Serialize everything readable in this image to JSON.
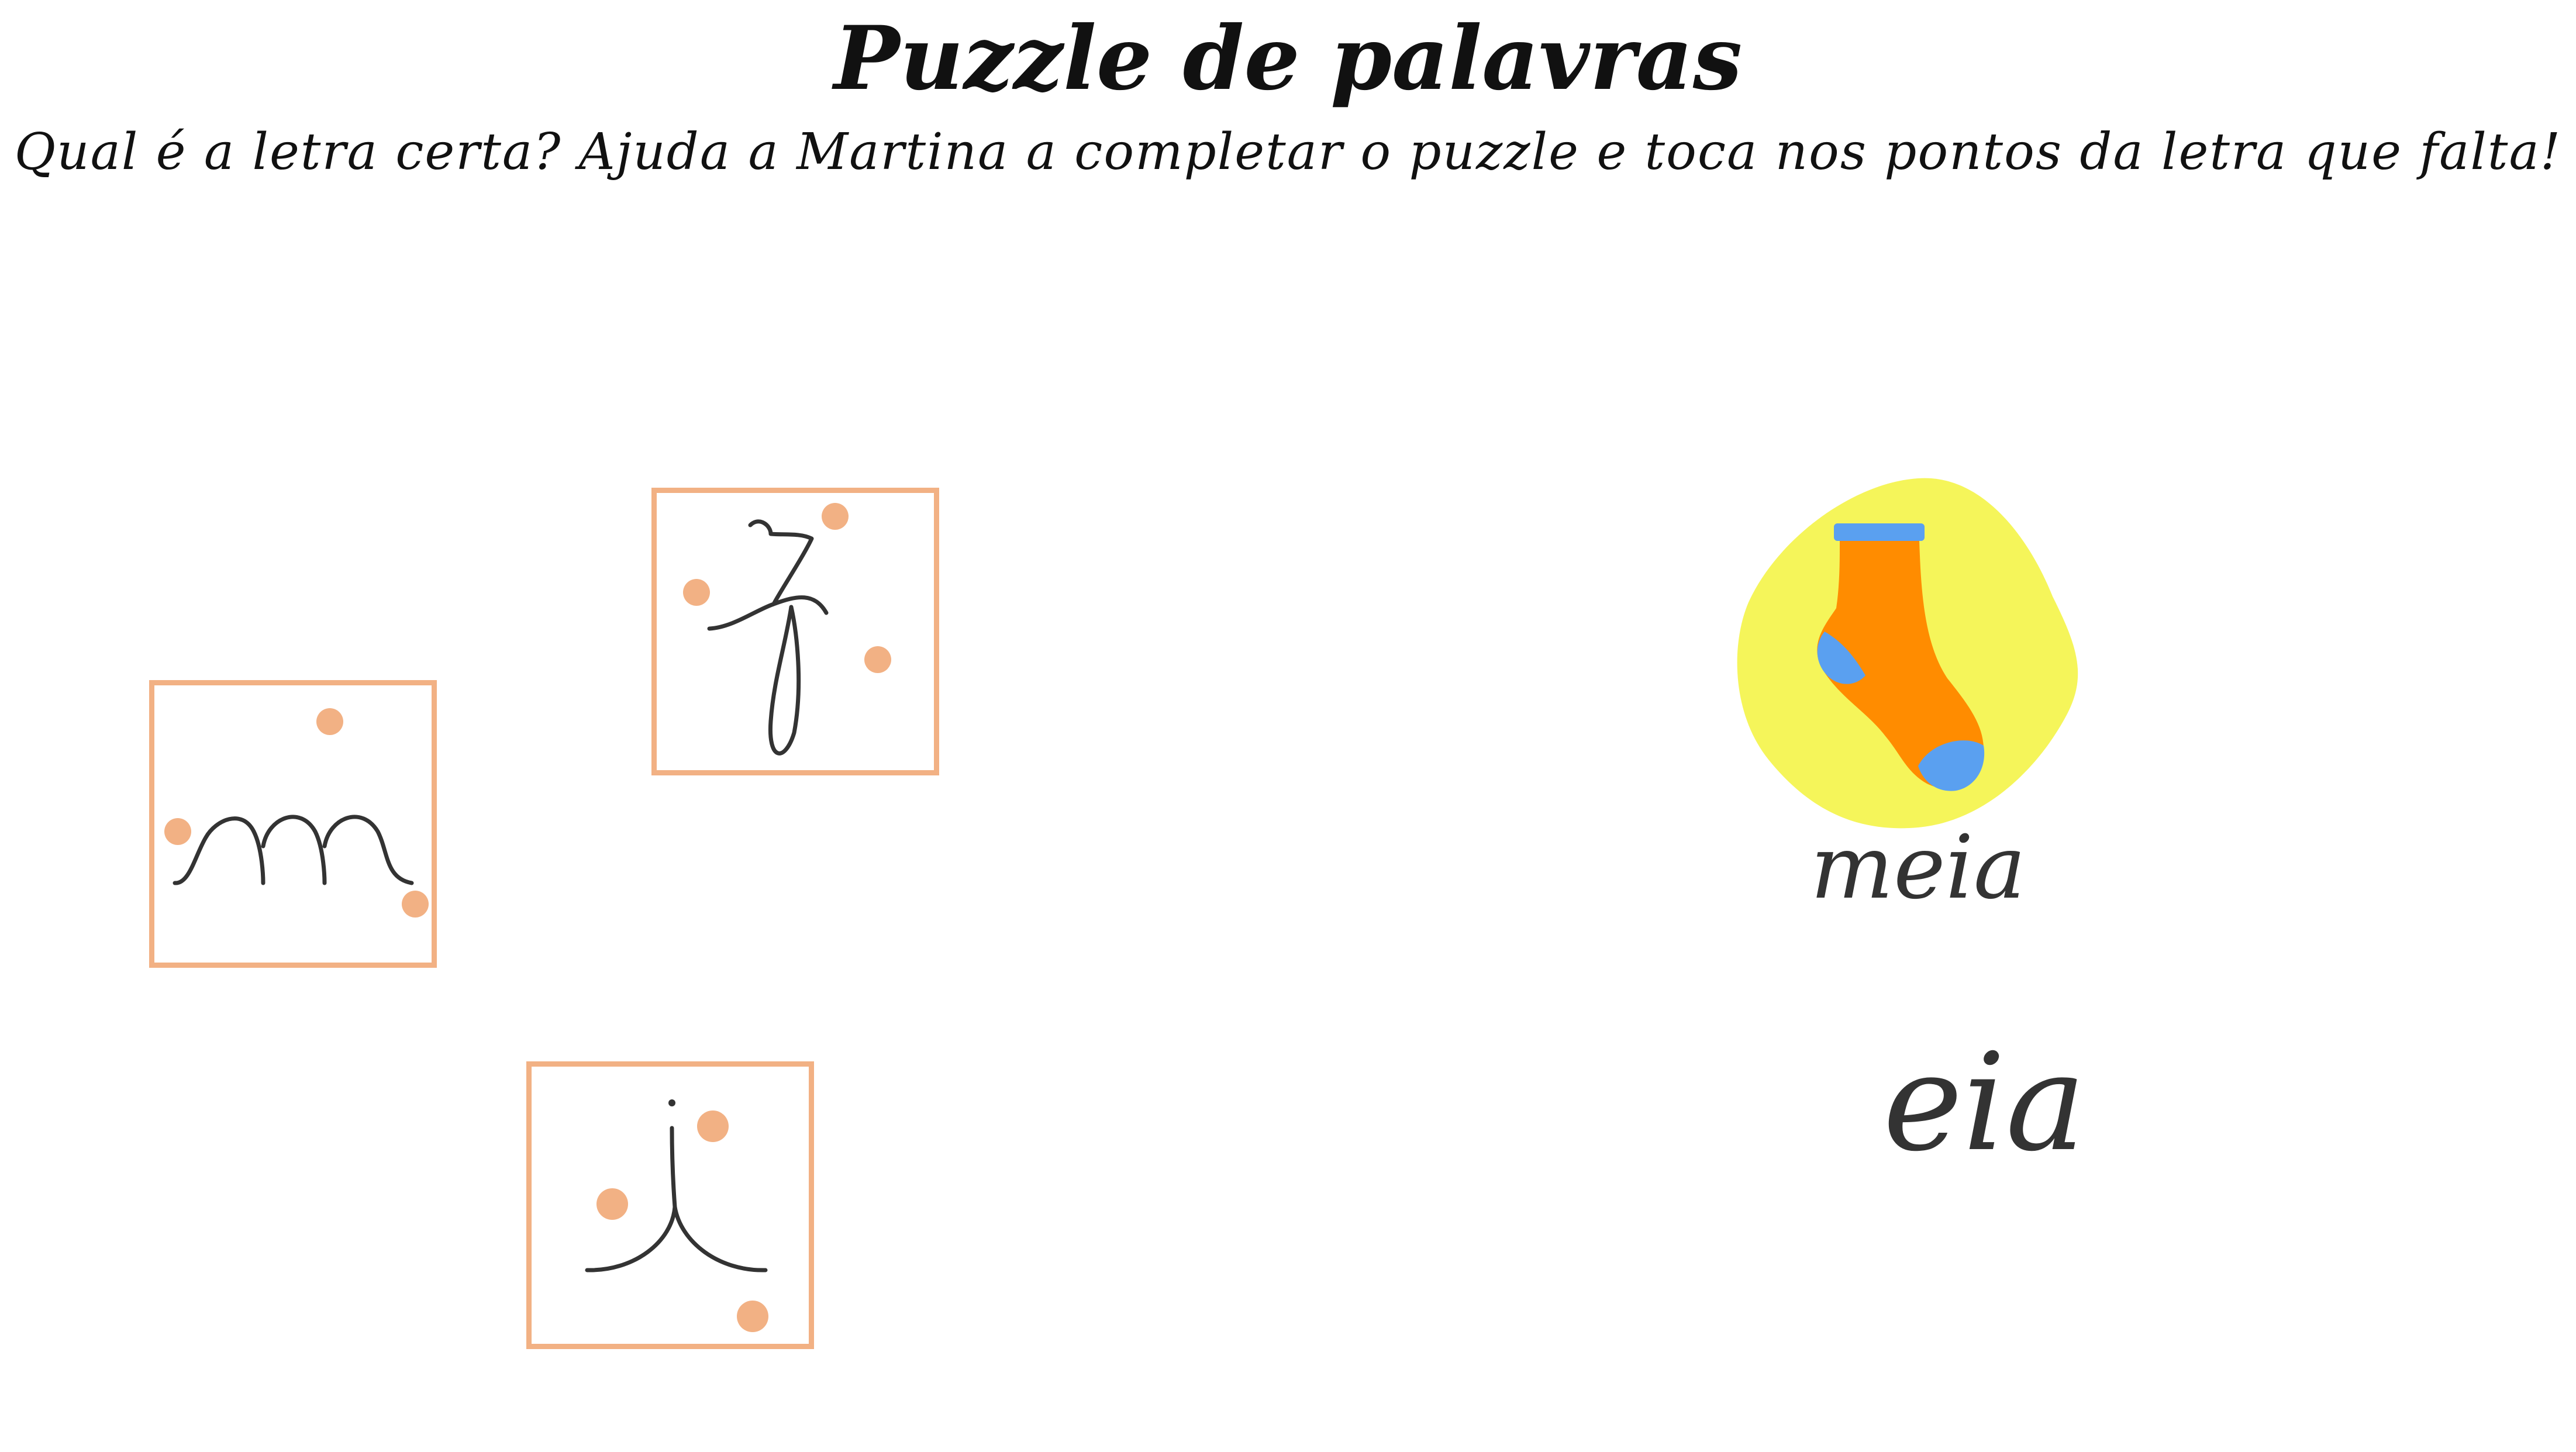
{
  "header": {
    "title": "Puzzle de palavras",
    "instructions": "Qual é a letra certa? Ajuda a Martina a completar o puzzle e toca nos pontos da letra que falta!"
  },
  "letter_tiles": [
    {
      "letter": "m",
      "icon": "letter-m-tracing-icon"
    },
    {
      "letter": "r",
      "icon": "letter-r-tracing-icon"
    },
    {
      "letter": "j",
      "icon": "letter-j-tracing-icon"
    }
  ],
  "target": {
    "picture_icon": "sock-icon",
    "word": "meia",
    "missing_letter_slot": "",
    "word_remainder": "eia"
  },
  "colors": {
    "tile_border": "#f2b184",
    "dot": "#f2b184",
    "stroke": "#333333",
    "blob": "#f5f55a",
    "sock_body": "#ff8c00",
    "sock_accent": "#5aa0f0"
  }
}
